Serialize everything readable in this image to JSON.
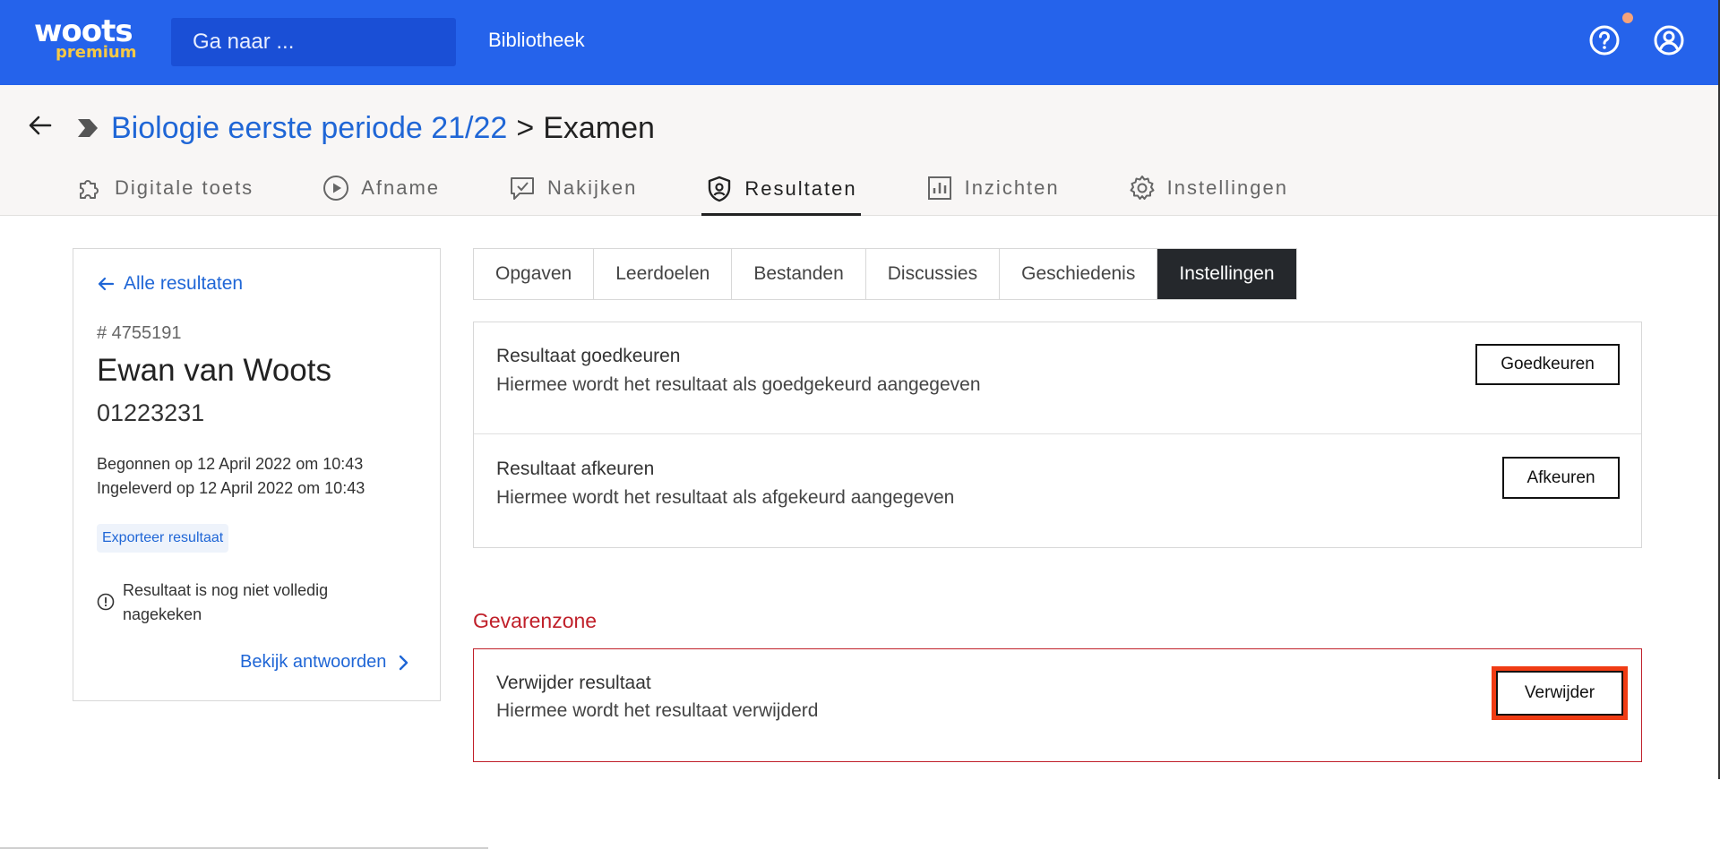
{
  "topbar": {
    "logo_main": "woots",
    "logo_sub": "premium",
    "search_placeholder": "Ga naar ...",
    "library_link": "Bibliotheek",
    "help_icon": "help-circle-icon",
    "user_icon": "user-circle-icon",
    "colors": {
      "bar": "#2563eb",
      "search": "#1a4fd6",
      "logo_sub": "#f6c945",
      "notification": "#f6a37a"
    }
  },
  "header": {
    "breadcrumb": {
      "parent": "Biologie eerste periode 21/22",
      "separator": ">",
      "current": "Examen"
    },
    "tabs": [
      {
        "label": "Digitale toets",
        "icon": "puzzle-icon"
      },
      {
        "label": "Afname",
        "icon": "play-circle-icon"
      },
      {
        "label": "Nakijken",
        "icon": "message-check-icon"
      },
      {
        "label": "Resultaten",
        "icon": "shield-icon",
        "active": true
      },
      {
        "label": "Inzichten",
        "icon": "bar-chart-icon"
      },
      {
        "label": "Instellingen",
        "icon": "gear-icon"
      }
    ]
  },
  "sidebar": {
    "back_link": "Alle resultaten",
    "result_id": "# 4755191",
    "student_name": "Ewan van Woots",
    "student_number": "01223231",
    "started": "Begonnen op 12 April 2022 om 10:43",
    "delivered": "Ingeleverd op 12 April 2022 om 10:43",
    "export_label": "Exporteer resultaat",
    "warning": "Resultaat is nog niet volledig nagekeken",
    "view_answers": "Bekijk antwoorden"
  },
  "subtabs": [
    {
      "label": "Opgaven"
    },
    {
      "label": "Leerdoelen"
    },
    {
      "label": "Bestanden"
    },
    {
      "label": "Discussies"
    },
    {
      "label": "Geschiedenis"
    },
    {
      "label": "Instellingen",
      "active": true
    }
  ],
  "settings": {
    "approve": {
      "title": "Resultaat goedkeuren",
      "description": "Hiermee wordt het resultaat als goedgekeurd aangegeven",
      "button": "Goedkeuren"
    },
    "reject": {
      "title": "Resultaat afkeuren",
      "description": "Hiermee wordt het resultaat als afgekeurd aangegeven",
      "button": "Afkeuren"
    }
  },
  "danger": {
    "title": "Gevarenzone",
    "delete": {
      "title": "Verwijder resultaat",
      "description": "Hiermee wordt het resultaat verwijderd",
      "button": "Verwijder"
    },
    "colors": {
      "text": "#c0202a",
      "highlight": "#f03c14"
    }
  }
}
